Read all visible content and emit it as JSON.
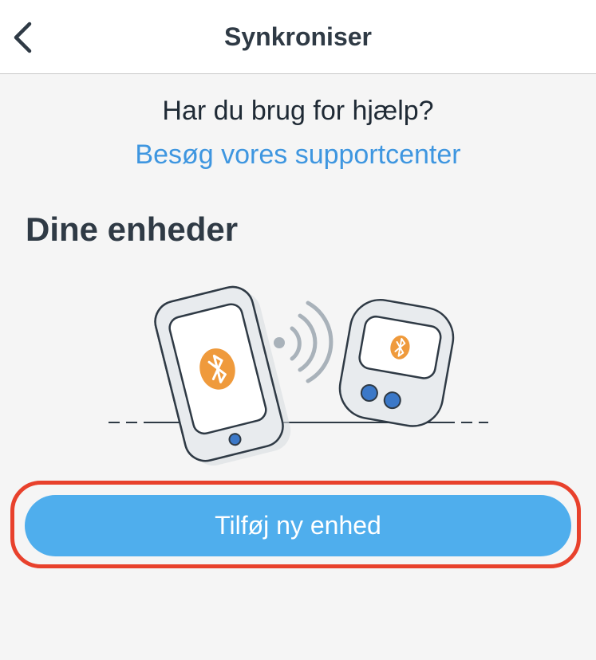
{
  "header": {
    "title": "Synkroniser",
    "back_icon": "chevron-left-icon"
  },
  "help": {
    "question": "Har du brug for hjælp?",
    "link_label": "Besøg vores supportcenter"
  },
  "devices": {
    "section_title": "Dine enheder",
    "illustration_icons": [
      "phone-icon",
      "bluetooth-icon",
      "signal-waves-icon",
      "tracker-device-icon"
    ]
  },
  "actions": {
    "add_device_label": "Tilføj ny enhed"
  },
  "colors": {
    "accent_blue": "#4faeed",
    "link_blue": "#3e96e0",
    "bluetooth_orange": "#ef9a3c",
    "highlight_red": "#e8412c",
    "text_dark": "#2f3a45"
  }
}
